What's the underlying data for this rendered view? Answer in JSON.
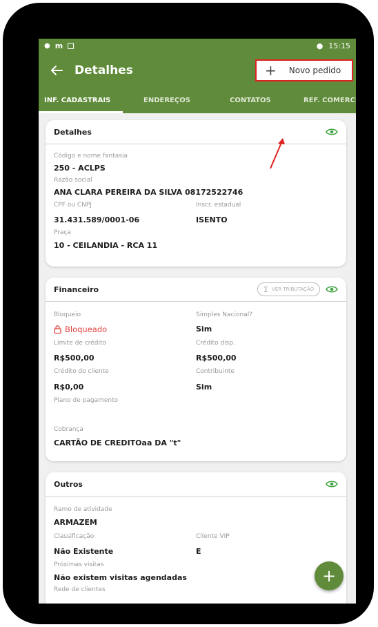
{
  "status_bar": {
    "time": "15:15"
  },
  "top_bar": {
    "title": "Detalhes",
    "new_order_label": "Novo pedido"
  },
  "tabs": [
    {
      "label": "INF. CADASTRAIS",
      "active": true
    },
    {
      "label": "ENDEREÇOS",
      "active": false
    },
    {
      "label": "CONTATOS",
      "active": false
    },
    {
      "label": "REF. COMERCIA",
      "active": false
    }
  ],
  "detalhes": {
    "title": "Detalhes",
    "codigo_label": "Código e nome fantasia",
    "codigo_value": "250 - ACLPS",
    "razao_label": "Razão social",
    "razao_value": "ANA CLARA PEREIRA DA SILVA 08172522746",
    "cpf_label": "CPF ou CNPJ",
    "cpf_value": "31.431.589/0001-06",
    "inscr_label": "Inscr. estadual",
    "inscr_value": "ISENTO",
    "praca_label": "Praça",
    "praca_value": "10 - CEILANDIA - RCA 11"
  },
  "financeiro": {
    "title": "Financeiro",
    "tributacao_button": "VER TRIBUTAÇÃO",
    "bloqueio_label": "Bloqueio",
    "bloqueio_value": "Bloqueado",
    "simples_label": "Simples Nacional?",
    "simples_value": "Sim",
    "limite_label": "Limite de crédito",
    "limite_value": "R$500,00",
    "credito_disp_label": "Crédito disp.",
    "credito_disp_value": "R$500,00",
    "credito_cliente_label": "Crédito do cliente",
    "credito_cliente_value": "R$0,00",
    "contribuinte_label": "Contribuinte",
    "contribuinte_value": "Sim",
    "plano_label": "Plano de pagamento",
    "cobranca_label": "Cobrança",
    "cobranca_value": "CARTÃO DE CREDITOaa  DA \"t\""
  },
  "outros": {
    "title": "Outros",
    "ramo_label": "Ramo de atividade",
    "ramo_value": "ARMAZEM",
    "classificacao_label": "Classificação",
    "classificacao_value": "Não Existente",
    "vip_label": "Cliente VIP",
    "vip_value": "E",
    "visitas_label": "Próximas visitas",
    "visitas_value": "Não existem visitas agendadas",
    "rede_label": "Rede de clientes"
  },
  "colors": {
    "brand_green": "#5f8b3a",
    "highlight_red": "#e02020",
    "blocked_red": "#e0413e",
    "eye_green": "#3fa33f"
  }
}
